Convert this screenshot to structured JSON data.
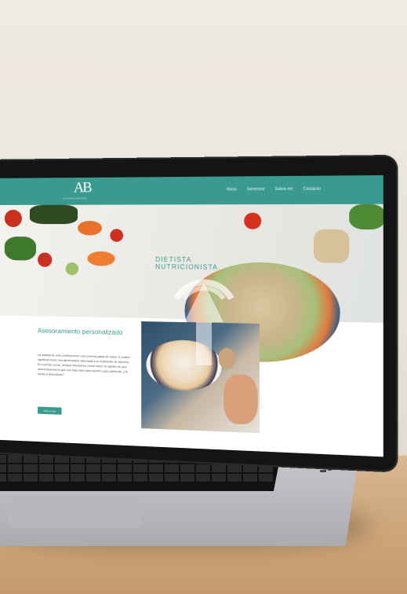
{
  "site": {
    "logo": "AB",
    "logo_sub": "NUTRICIONISTA",
    "nav": [
      "Inicio",
      "Servicios",
      "Sobre mí",
      "Contacto"
    ],
    "hero_title_line1": "DIETISTA",
    "hero_title_line2": "NUTRICIONISTA"
  },
  "card": {
    "title": "Asesoramiento personalizado",
    "text": "La calidad de vida conlleva tener una correcta pauta de salud, lo cuales significan tener una alimentación adecuada y la realización de ejercicio. En muchas cosas, aunque intentamos comer sano, la rapidez en que desconocemos lo que nos hace bien para nuestro caso particular. ¿Te ayudo a descubrirlo?",
    "button": "Pide tu cita"
  },
  "colors": {
    "accent": "#3a9a8f",
    "wall": "#ede8e0",
    "desk": "#cfa97f"
  }
}
